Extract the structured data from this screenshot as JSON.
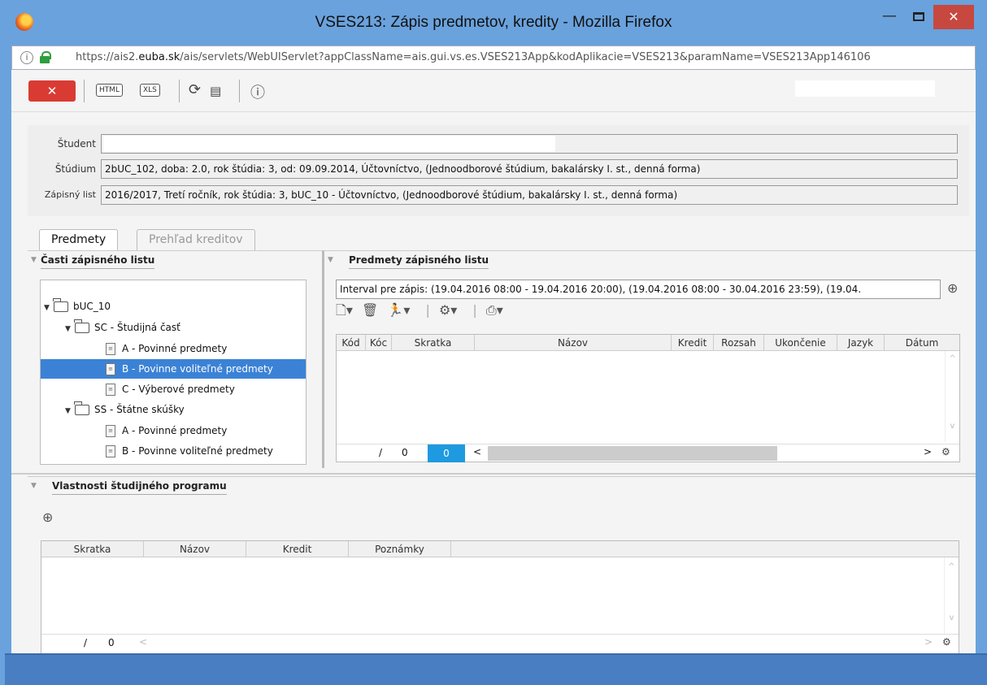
{
  "window": {
    "title": "VSES213: Zápis predmetov, kredity - Mozilla Firefox",
    "minimize": "—",
    "close": "✕"
  },
  "urlbar": {
    "prefix": "https://ais2.",
    "domain": "euba.sk",
    "rest": "/ais/servlets/WebUIServlet?appClassName=ais.gui.vs.es.VSES213App&kodAplikacie=VSES213&paramName=VSES213App146106"
  },
  "toolbar": {
    "close_label": "✕",
    "html_label": "HTML",
    "xls_label": "XLS"
  },
  "header": {
    "student_label": "Študent",
    "student_value": "",
    "studium_label": "Štúdium",
    "studium_value": "2bUC_102, doba: 2.0, rok štúdia: 3, od: 09.09.2014, Účtovníctvo, (Jednoodborové štúdium, bakalársky I. st., denná forma)",
    "zapisny_label": "Zápisný list",
    "zapisny_value": "2016/2017, Tretí ročník, rok štúdia: 3, bUC_10 - Účtovníctvo, (Jednoodborové štúdium, bakalársky I. st., denná forma)"
  },
  "tabs": [
    {
      "label": "Predmety",
      "active": true
    },
    {
      "label": "Prehľad kreditov",
      "active": false
    }
  ],
  "left_panel": {
    "title": "Časti zápisného listu",
    "tree": [
      {
        "label": "bUC_10",
        "level": 0,
        "type": "folder"
      },
      {
        "label": "SC - Študijná časť",
        "level": 1,
        "type": "folder"
      },
      {
        "label": "A - Povinné predmety",
        "level": 2,
        "type": "doc"
      },
      {
        "label": "B - Povinne voliteľné predmety",
        "level": 2,
        "type": "doc",
        "selected": true
      },
      {
        "label": "C - Výberové predmety",
        "level": 2,
        "type": "doc"
      },
      {
        "label": "SS - Štátne skúšky",
        "level": 1,
        "type": "folder"
      },
      {
        "label": "A - Povinné predmety",
        "level": 2,
        "type": "doc"
      },
      {
        "label": "B - Povinne voliteľné predmety",
        "level": 2,
        "type": "doc"
      }
    ]
  },
  "right_panel": {
    "title": "Predmety zápisného listu",
    "interval": "Interval pre zápis: (19.04.2016 08:00 - 19.04.2016 20:00), (19.04.2016 08:00 - 30.04.2016 23:59), (19.04.",
    "columns": [
      "Kód",
      "Kóc",
      "Skratka",
      "Názov",
      "Kredit",
      "Rozsah",
      "Ukončenie",
      "Jazyk",
      "Dátum"
    ],
    "footer": {
      "slash": "/",
      "count": "0",
      "selected": "0"
    }
  },
  "bottom_panel": {
    "title": "Vlastnosti študijného programu",
    "columns": [
      "Skratka",
      "Názov",
      "Kredit",
      "Poznámky"
    ],
    "footer": {
      "slash": "/",
      "count": "0"
    }
  },
  "colors": {
    "selection": "#3b82d6",
    "close": "#d93b33",
    "titlebar": "#6aa2dd"
  }
}
